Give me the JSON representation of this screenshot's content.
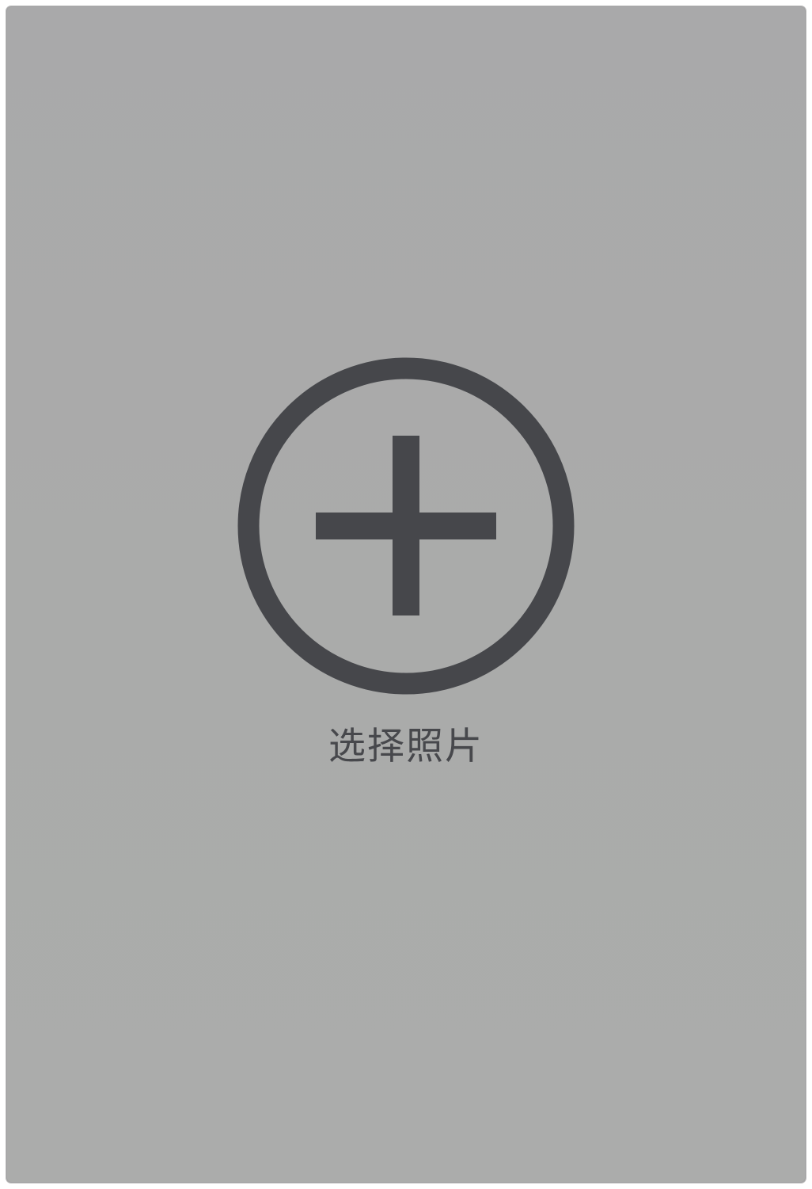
{
  "photo_picker": {
    "label": "选择照片",
    "icon": "plus-circle-icon",
    "background_color": "#aaaaaa",
    "icon_color": "#46474b"
  }
}
